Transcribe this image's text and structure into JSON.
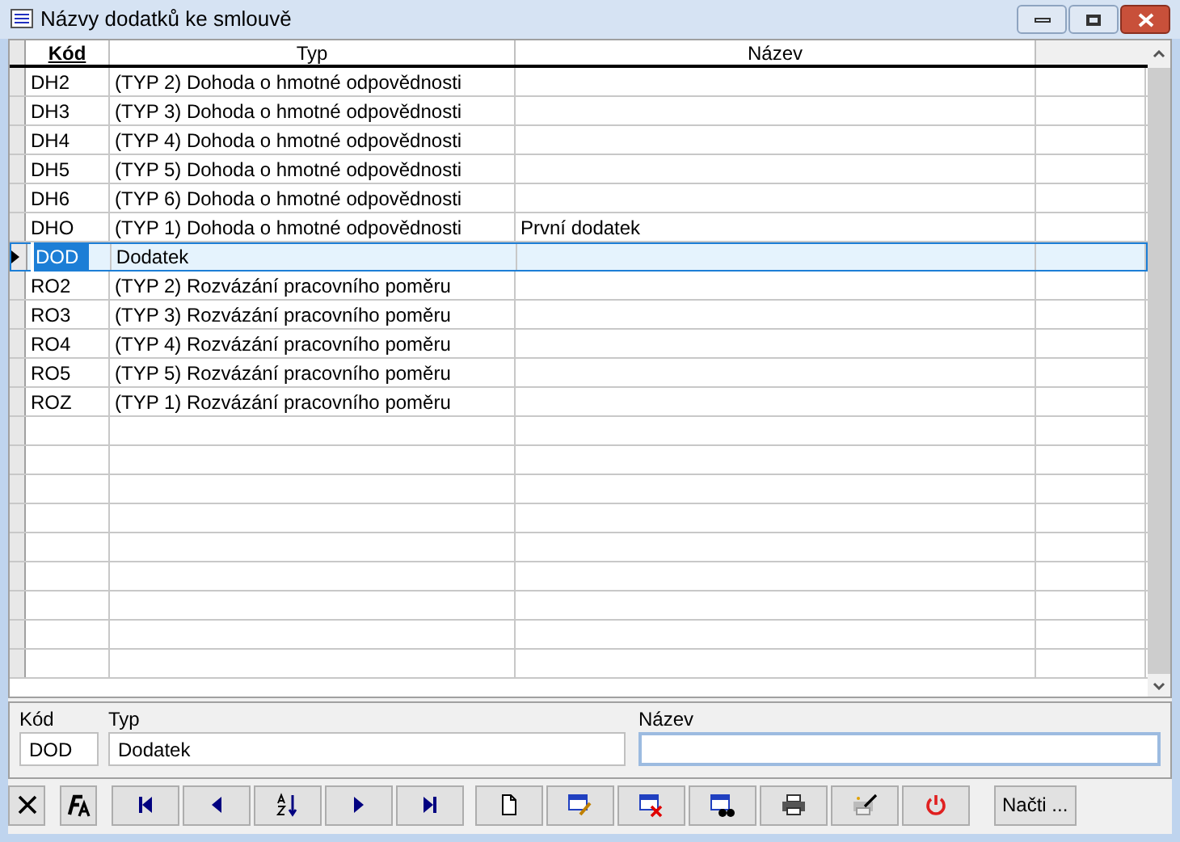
{
  "window": {
    "title": "Názvy dodatků ke smlouvě"
  },
  "table": {
    "columns": [
      {
        "label": "Kód",
        "sorted": true
      },
      {
        "label": "Typ",
        "sorted": false
      },
      {
        "label": "Název",
        "sorted": false
      }
    ],
    "rows": [
      {
        "cells": [
          "DH2",
          "(TYP 2) Dohoda o hmotné odpovědnosti"
        ],
        "selected": false
      },
      {
        "cells": [
          "DH3",
          "(TYP 3) Dohoda o hmotné odpovědnosti"
        ],
        "selected": false
      },
      {
        "cells": [
          "DH4",
          "(TYP 4) Dohoda o hmotné odpovědnosti"
        ],
        "selected": false
      },
      {
        "cells": [
          "DH5",
          "(TYP 5) Dohoda o hmotné odpovědnosti"
        ],
        "selected": false
      },
      {
        "cells": [
          "DH6",
          "(TYP 6) Dohoda o hmotné odpovědnosti"
        ],
        "selected": false
      },
      {
        "cells": [
          "DHO",
          "(TYP 1) Dohoda o hmotné odpovědnosti",
          "První dodatek"
        ],
        "selected": false
      },
      {
        "cells": [
          "DOD",
          "Dodatek"
        ],
        "selected": true
      },
      {
        "cells": [
          "RO2",
          "(TYP 2) Rozvázání pracovního poměru"
        ],
        "selected": false
      },
      {
        "cells": [
          "RO3",
          "(TYP 3) Rozvázání pracovního poměru"
        ],
        "selected": false
      },
      {
        "cells": [
          "RO4",
          "(TYP 4) Rozvázání pracovního poměru"
        ],
        "selected": false
      },
      {
        "cells": [
          "RO5",
          "(TYP 5) Rozvázání pracovního poměru"
        ],
        "selected": false
      },
      {
        "cells": [
          "ROZ",
          "(TYP 1) Rozvázání pracovního poměru"
        ],
        "selected": false
      }
    ]
  },
  "detail": {
    "fields": [
      {
        "label": "Kód",
        "value": "DOD"
      },
      {
        "label": "Typ",
        "value": "Dodatek"
      },
      {
        "label": "Název"
      }
    ]
  },
  "toolbar": {
    "buttons": [
      {
        "kind": "cancel"
      },
      {
        "kind": "font"
      },
      {
        "kind": "first"
      },
      {
        "kind": "prev"
      },
      {
        "kind": "sort"
      },
      {
        "kind": "next"
      },
      {
        "kind": "last"
      },
      {
        "kind": "new"
      },
      {
        "kind": "edit"
      },
      {
        "kind": "delete"
      },
      {
        "kind": "find"
      },
      {
        "kind": "print"
      },
      {
        "kind": "print-setup"
      },
      {
        "kind": "power"
      }
    ],
    "load_button": "Načti ..."
  }
}
